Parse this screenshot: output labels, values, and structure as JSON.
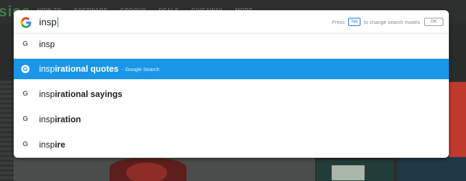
{
  "background": {
    "site_logo": "sies",
    "nav_links": [
      "HOW-TO",
      "SOFTWARE",
      "GROOVY",
      "DEALS",
      "GIVEAWAY",
      "MORE"
    ]
  },
  "omnibox": {
    "input_value": "insp",
    "hint_press": "Press",
    "hint_key": "Tab",
    "hint_suffix": "to change search modes",
    "ok_label": "OK",
    "suggestions": [
      {
        "typed": "insp",
        "completion": "",
        "meta": ""
      },
      {
        "typed": "insp",
        "completion": "irational quotes",
        "meta": "- Google Search"
      },
      {
        "typed": "insp",
        "completion": "irational sayings",
        "meta": ""
      },
      {
        "typed": "insp",
        "completion": "iration",
        "meta": ""
      },
      {
        "typed": "insp",
        "completion": "ire",
        "meta": ""
      }
    ]
  },
  "icons": {
    "provider": "google-g-icon"
  },
  "colors": {
    "selection": "#1a96e8",
    "accent": "#1a73e8"
  }
}
